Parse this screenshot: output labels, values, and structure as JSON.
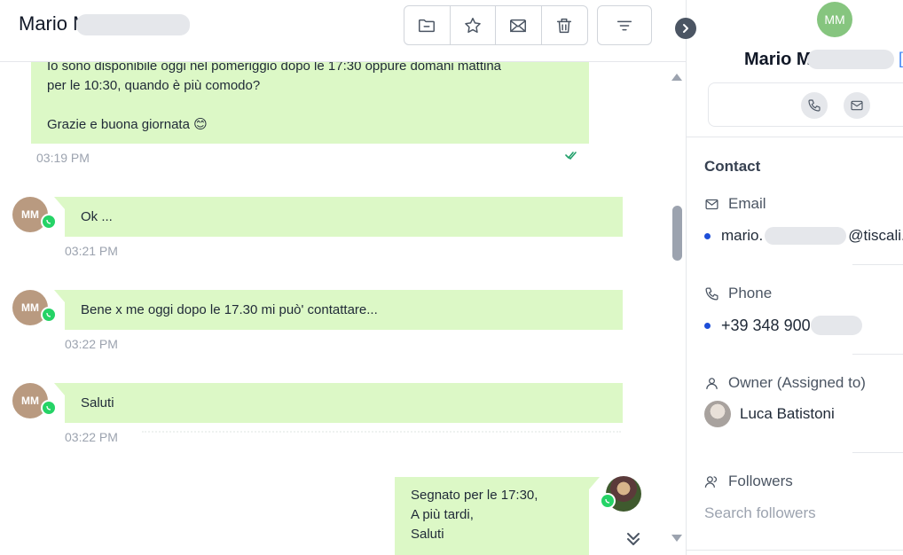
{
  "chat": {
    "contact_title": "Mario M",
    "toolbar": {
      "folder_icon": "folder-minus-icon",
      "star_icon": "star-icon",
      "mail_icon": "mail-icon",
      "trash_icon": "trash-icon",
      "filter_icon": "filter-lines-icon"
    },
    "messages": [
      {
        "direction": "incoming",
        "text_lines": [
          "Io sono disponibile oggi nel pomeriggio dopo le 17:30 oppure domani mattina",
          "per le 10:30, quando è più comodo?",
          "",
          "Grazie e buona giornata 😊"
        ],
        "time": "03:19 PM",
        "status": "double-check"
      },
      {
        "direction": "incoming",
        "sender_initials": "MM",
        "text": "Ok ...",
        "time": "03:21 PM",
        "channel": "whatsapp"
      },
      {
        "direction": "incoming",
        "sender_initials": "MM",
        "text": "Bene x me oggi dopo le 17.30 mi può' contattare...",
        "time": "03:22 PM",
        "channel": "whatsapp"
      },
      {
        "direction": "incoming",
        "sender_initials": "MM",
        "text": "Saluti",
        "time": "03:22 PM",
        "channel": "whatsapp"
      },
      {
        "direction": "outgoing",
        "text_lines": [
          "Segnato per le 17:30,",
          "A più tardi,",
          "Saluti"
        ],
        "channel": "whatsapp"
      }
    ]
  },
  "side": {
    "avatar_initials": "MM",
    "name": "Mario M",
    "contact_heading": "Contact",
    "email_label": "Email",
    "email_value_start": "mario.",
    "email_value_end": "@tiscali.",
    "phone_label": "Phone",
    "phone_value": "+39 348 900",
    "owner_label": "Owner (Assigned to)",
    "owner_name": "Luca Batistoni",
    "followers_label": "Followers",
    "followers_placeholder": "Search followers"
  },
  "colors": {
    "bubble": "#dcf8c6",
    "whatsapp": "#25d366",
    "avatar_incoming": "#b99a80",
    "avatar_side": "#86c57f",
    "accent_blue": "#1d4ed8"
  }
}
